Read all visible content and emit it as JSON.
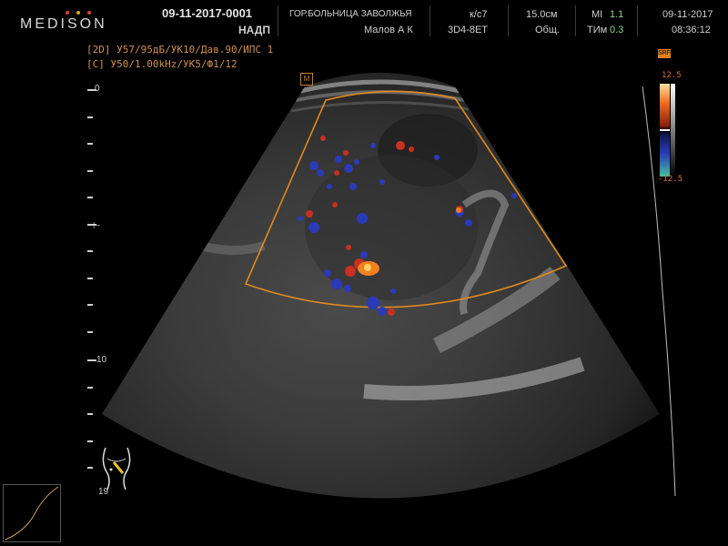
{
  "header": {
    "brand": "MEDISON",
    "exam_id": "09-11-2017-0001",
    "exam_sub": "НАДП",
    "hospital": "ГОР.БОЛЬНИЦА ЗАВОЛЖЬЯ",
    "operator": "Малов А К",
    "frame_rate": "к/с7",
    "probe": "3D4-8ET",
    "depth": "15.0см",
    "preset": "Общ.",
    "mi_label": "MI",
    "mi_value": "1.1",
    "tim_label": "ТИм",
    "tim_value": "0.3",
    "date": "09-11-2017",
    "time": "08:36:12"
  },
  "params": {
    "line_2d": "[2D] У57/95дБ/УК10/Дав.90/ИПС 1",
    "line_c": "[C] У50/1.00kHz/УК5/Ф1/12"
  },
  "scale": {
    "label_0": "0",
    "label_10": "10",
    "probe_label": "19"
  },
  "colorbar": {
    "top_value": "12.5",
    "bottom_value": "-12.5",
    "badge": "SRF"
  },
  "markers": {
    "m_badge": "M"
  },
  "colors": {
    "roi_outline": "#e08a1e",
    "flow_red": "#c83020",
    "flow_blue": "#2a3ab8",
    "flow_orange": "#f08020",
    "param_text": "#d09050",
    "logo_dot_1": "#e04030",
    "logo_dot_2": "#e0a030",
    "logo_dot_3": "#e04030"
  }
}
